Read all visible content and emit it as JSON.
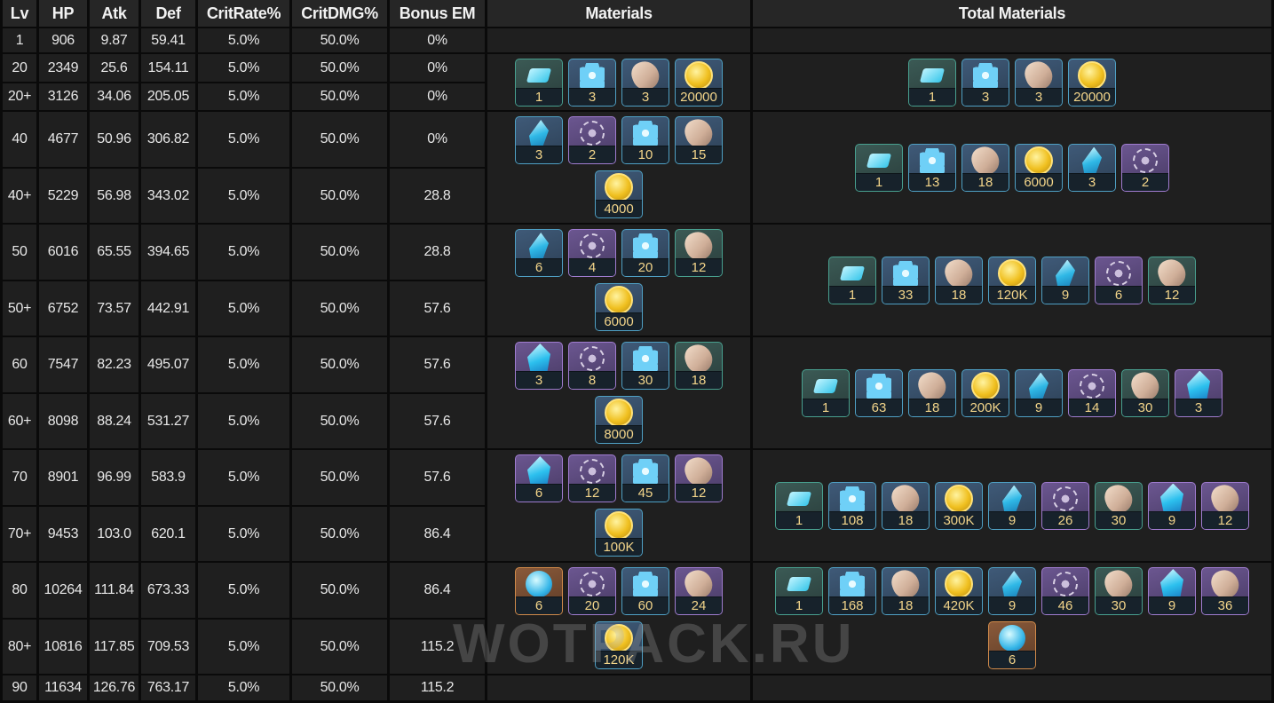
{
  "headers": [
    "Lv",
    "HP",
    "Atk",
    "Def",
    "CritRate%",
    "CritDMG%",
    "Bonus EM",
    "Materials",
    "Total Materials"
  ],
  "rows": [
    [
      "1",
      "906",
      "9.87",
      "59.41",
      "5.0%",
      "50.0%",
      "0%"
    ],
    [
      "20",
      "2349",
      "25.6",
      "154.11",
      "5.0%",
      "50.0%",
      "0%"
    ],
    [
      "20+",
      "3126",
      "34.06",
      "205.05",
      "5.0%",
      "50.0%",
      "0%"
    ],
    [
      "40",
      "4677",
      "50.96",
      "306.82",
      "5.0%",
      "50.0%",
      "0%"
    ],
    [
      "40+",
      "5229",
      "56.98",
      "343.02",
      "5.0%",
      "50.0%",
      "28.8"
    ],
    [
      "50",
      "6016",
      "65.55",
      "394.65",
      "5.0%",
      "50.0%",
      "28.8"
    ],
    [
      "50+",
      "6752",
      "73.57",
      "442.91",
      "5.0%",
      "50.0%",
      "57.6"
    ],
    [
      "60",
      "7547",
      "82.23",
      "495.07",
      "5.0%",
      "50.0%",
      "57.6"
    ],
    [
      "60+",
      "8098",
      "88.24",
      "531.27",
      "5.0%",
      "50.0%",
      "57.6"
    ],
    [
      "70",
      "8901",
      "96.99",
      "583.9",
      "5.0%",
      "50.0%",
      "57.6"
    ],
    [
      "70+",
      "9453",
      "103.0",
      "620.1",
      "5.0%",
      "50.0%",
      "86.4"
    ],
    [
      "80",
      "10264",
      "111.84",
      "673.33",
      "5.0%",
      "50.0%",
      "86.4"
    ],
    [
      "80+",
      "10816",
      "117.85",
      "709.53",
      "5.0%",
      "50.0%",
      "115.2"
    ],
    [
      "90",
      "11634",
      "126.76",
      "763.17",
      "5.0%",
      "50.0%",
      "115.2"
    ]
  ],
  "materials": [
    [],
    [
      [
        {
          "icon": "gem-icon",
          "rarity": "green",
          "count": "1"
        },
        {
          "icon": "flower-icon",
          "rarity": "blue",
          "count": "3"
        },
        {
          "icon": "stone-icon",
          "rarity": "blue",
          "count": "3"
        },
        {
          "icon": "mora-coin-icon",
          "rarity": "blue",
          "count": "20000"
        }
      ]
    ],
    [
      [
        {
          "icon": "crystal-icon",
          "rarity": "blue",
          "count": "3"
        },
        {
          "icon": "scroll-icon",
          "rarity": "purple",
          "count": "2"
        },
        {
          "icon": "flower-icon",
          "rarity": "blue",
          "count": "10"
        },
        {
          "icon": "stone-icon",
          "rarity": "blue",
          "count": "15"
        }
      ],
      [
        {
          "icon": "mora-coin-icon",
          "rarity": "blue",
          "count": "4000"
        }
      ]
    ],
    [
      [
        {
          "icon": "crystal-icon",
          "rarity": "blue",
          "count": "6"
        },
        {
          "icon": "scroll-icon",
          "rarity": "purple",
          "count": "4"
        },
        {
          "icon": "flower-icon",
          "rarity": "blue",
          "count": "20"
        },
        {
          "icon": "stone-icon",
          "rarity": "green",
          "count": "12"
        }
      ],
      [
        {
          "icon": "mora-coin-icon",
          "rarity": "blue",
          "count": "6000"
        }
      ]
    ],
    [
      [
        {
          "icon": "bigcrystal-icon",
          "rarity": "purple",
          "count": "3"
        },
        {
          "icon": "scroll-icon",
          "rarity": "purple",
          "count": "8"
        },
        {
          "icon": "flower-icon",
          "rarity": "blue",
          "count": "30"
        },
        {
          "icon": "stone-icon",
          "rarity": "green",
          "count": "18"
        }
      ],
      [
        {
          "icon": "mora-coin-icon",
          "rarity": "blue",
          "count": "8000"
        }
      ]
    ],
    [
      [
        {
          "icon": "bigcrystal-icon",
          "rarity": "purple",
          "count": "6"
        },
        {
          "icon": "scroll-icon",
          "rarity": "purple",
          "count": "12"
        },
        {
          "icon": "flower-icon",
          "rarity": "blue",
          "count": "45"
        },
        {
          "icon": "stone-icon",
          "rarity": "purple",
          "count": "12"
        }
      ],
      [
        {
          "icon": "mora-coin-icon",
          "rarity": "blue",
          "count": "100K"
        }
      ]
    ],
    [
      [
        {
          "icon": "orb-icon",
          "rarity": "orange",
          "count": "6"
        },
        {
          "icon": "scroll-icon",
          "rarity": "purple",
          "count": "20"
        },
        {
          "icon": "flower-icon",
          "rarity": "blue",
          "count": "60"
        },
        {
          "icon": "stone-icon",
          "rarity": "purple",
          "count": "24"
        }
      ],
      [
        {
          "icon": "mora-coin-icon",
          "rarity": "blue",
          "count": "120K"
        }
      ]
    ],
    []
  ],
  "totals": [
    [],
    [
      [
        {
          "icon": "gem-icon",
          "rarity": "green",
          "count": "1"
        },
        {
          "icon": "flower-icon",
          "rarity": "blue",
          "count": "3"
        },
        {
          "icon": "stone-icon",
          "rarity": "blue",
          "count": "3"
        },
        {
          "icon": "mora-coin-icon",
          "rarity": "blue",
          "count": "20000"
        }
      ]
    ],
    [
      [
        {
          "icon": "gem-icon",
          "rarity": "green",
          "count": "1"
        },
        {
          "icon": "flower-icon",
          "rarity": "blue",
          "count": "13"
        },
        {
          "icon": "stone-icon",
          "rarity": "blue",
          "count": "18"
        },
        {
          "icon": "mora-coin-icon",
          "rarity": "blue",
          "count": "6000"
        },
        {
          "icon": "crystal-icon",
          "rarity": "blue",
          "count": "3"
        },
        {
          "icon": "scroll-icon",
          "rarity": "purple",
          "count": "2"
        }
      ]
    ],
    [
      [
        {
          "icon": "gem-icon",
          "rarity": "green",
          "count": "1"
        },
        {
          "icon": "flower-icon",
          "rarity": "blue",
          "count": "33"
        },
        {
          "icon": "stone-icon",
          "rarity": "blue",
          "count": "18"
        },
        {
          "icon": "mora-coin-icon",
          "rarity": "blue",
          "count": "120K"
        },
        {
          "icon": "crystal-icon",
          "rarity": "blue",
          "count": "9"
        },
        {
          "icon": "scroll-icon",
          "rarity": "purple",
          "count": "6"
        },
        {
          "icon": "stone-icon",
          "rarity": "green",
          "count": "12"
        }
      ]
    ],
    [
      [
        {
          "icon": "gem-icon",
          "rarity": "green",
          "count": "1"
        },
        {
          "icon": "flower-icon",
          "rarity": "blue",
          "count": "63"
        },
        {
          "icon": "stone-icon",
          "rarity": "blue",
          "count": "18"
        },
        {
          "icon": "mora-coin-icon",
          "rarity": "blue",
          "count": "200K"
        },
        {
          "icon": "crystal-icon",
          "rarity": "blue",
          "count": "9"
        },
        {
          "icon": "scroll-icon",
          "rarity": "purple",
          "count": "14"
        },
        {
          "icon": "stone-icon",
          "rarity": "green",
          "count": "30"
        },
        {
          "icon": "bigcrystal-icon",
          "rarity": "purple",
          "count": "3"
        }
      ]
    ],
    [
      [
        {
          "icon": "gem-icon",
          "rarity": "green",
          "count": "1"
        },
        {
          "icon": "flower-icon",
          "rarity": "blue",
          "count": "108"
        },
        {
          "icon": "stone-icon",
          "rarity": "blue",
          "count": "18"
        },
        {
          "icon": "mora-coin-icon",
          "rarity": "blue",
          "count": "300K"
        },
        {
          "icon": "crystal-icon",
          "rarity": "blue",
          "count": "9"
        },
        {
          "icon": "scroll-icon",
          "rarity": "purple",
          "count": "26"
        },
        {
          "icon": "stone-icon",
          "rarity": "green",
          "count": "30"
        },
        {
          "icon": "bigcrystal-icon",
          "rarity": "purple",
          "count": "9"
        },
        {
          "icon": "stone-icon",
          "rarity": "purple",
          "count": "12"
        }
      ]
    ],
    [
      [
        {
          "icon": "gem-icon",
          "rarity": "green",
          "count": "1"
        },
        {
          "icon": "flower-icon",
          "rarity": "blue",
          "count": "168"
        },
        {
          "icon": "stone-icon",
          "rarity": "blue",
          "count": "18"
        },
        {
          "icon": "mora-coin-icon",
          "rarity": "blue",
          "count": "420K"
        },
        {
          "icon": "crystal-icon",
          "rarity": "blue",
          "count": "9"
        },
        {
          "icon": "scroll-icon",
          "rarity": "purple",
          "count": "46"
        },
        {
          "icon": "stone-icon",
          "rarity": "green",
          "count": "30"
        },
        {
          "icon": "bigcrystal-icon",
          "rarity": "purple",
          "count": "9"
        },
        {
          "icon": "stone-icon",
          "rarity": "purple",
          "count": "36"
        }
      ],
      [
        {
          "icon": "orb-icon",
          "rarity": "orange",
          "count": "6"
        }
      ]
    ],
    []
  ],
  "watermark": "WOTPACK.RU"
}
